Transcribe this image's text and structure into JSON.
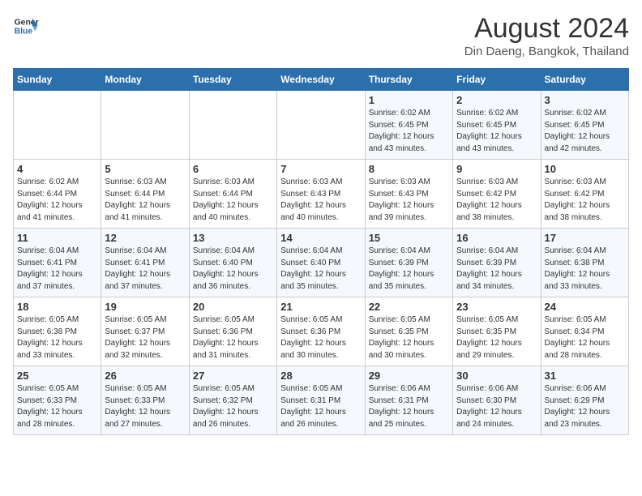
{
  "header": {
    "logo_line1": "General",
    "logo_line2": "Blue",
    "title": "August 2024",
    "subtitle": "Din Daeng, Bangkok, Thailand"
  },
  "days": [
    "Sunday",
    "Monday",
    "Tuesday",
    "Wednesday",
    "Thursday",
    "Friday",
    "Saturday"
  ],
  "weeks": [
    [
      {
        "date": "",
        "info": ""
      },
      {
        "date": "",
        "info": ""
      },
      {
        "date": "",
        "info": ""
      },
      {
        "date": "",
        "info": ""
      },
      {
        "date": "1",
        "info": "Sunrise: 6:02 AM\nSunset: 6:45 PM\nDaylight: 12 hours\nand 43 minutes."
      },
      {
        "date": "2",
        "info": "Sunrise: 6:02 AM\nSunset: 6:45 PM\nDaylight: 12 hours\nand 43 minutes."
      },
      {
        "date": "3",
        "info": "Sunrise: 6:02 AM\nSunset: 6:45 PM\nDaylight: 12 hours\nand 42 minutes."
      }
    ],
    [
      {
        "date": "4",
        "info": "Sunrise: 6:02 AM\nSunset: 6:44 PM\nDaylight: 12 hours\nand 41 minutes."
      },
      {
        "date": "5",
        "info": "Sunrise: 6:03 AM\nSunset: 6:44 PM\nDaylight: 12 hours\nand 41 minutes."
      },
      {
        "date": "6",
        "info": "Sunrise: 6:03 AM\nSunset: 6:44 PM\nDaylight: 12 hours\nand 40 minutes."
      },
      {
        "date": "7",
        "info": "Sunrise: 6:03 AM\nSunset: 6:43 PM\nDaylight: 12 hours\nand 40 minutes."
      },
      {
        "date": "8",
        "info": "Sunrise: 6:03 AM\nSunset: 6:43 PM\nDaylight: 12 hours\nand 39 minutes."
      },
      {
        "date": "9",
        "info": "Sunrise: 6:03 AM\nSunset: 6:42 PM\nDaylight: 12 hours\nand 38 minutes."
      },
      {
        "date": "10",
        "info": "Sunrise: 6:03 AM\nSunset: 6:42 PM\nDaylight: 12 hours\nand 38 minutes."
      }
    ],
    [
      {
        "date": "11",
        "info": "Sunrise: 6:04 AM\nSunset: 6:41 PM\nDaylight: 12 hours\nand 37 minutes."
      },
      {
        "date": "12",
        "info": "Sunrise: 6:04 AM\nSunset: 6:41 PM\nDaylight: 12 hours\nand 37 minutes."
      },
      {
        "date": "13",
        "info": "Sunrise: 6:04 AM\nSunset: 6:40 PM\nDaylight: 12 hours\nand 36 minutes."
      },
      {
        "date": "14",
        "info": "Sunrise: 6:04 AM\nSunset: 6:40 PM\nDaylight: 12 hours\nand 35 minutes."
      },
      {
        "date": "15",
        "info": "Sunrise: 6:04 AM\nSunset: 6:39 PM\nDaylight: 12 hours\nand 35 minutes."
      },
      {
        "date": "16",
        "info": "Sunrise: 6:04 AM\nSunset: 6:39 PM\nDaylight: 12 hours\nand 34 minutes."
      },
      {
        "date": "17",
        "info": "Sunrise: 6:04 AM\nSunset: 6:38 PM\nDaylight: 12 hours\nand 33 minutes."
      }
    ],
    [
      {
        "date": "18",
        "info": "Sunrise: 6:05 AM\nSunset: 6:38 PM\nDaylight: 12 hours\nand 33 minutes."
      },
      {
        "date": "19",
        "info": "Sunrise: 6:05 AM\nSunset: 6:37 PM\nDaylight: 12 hours\nand 32 minutes."
      },
      {
        "date": "20",
        "info": "Sunrise: 6:05 AM\nSunset: 6:36 PM\nDaylight: 12 hours\nand 31 minutes."
      },
      {
        "date": "21",
        "info": "Sunrise: 6:05 AM\nSunset: 6:36 PM\nDaylight: 12 hours\nand 30 minutes."
      },
      {
        "date": "22",
        "info": "Sunrise: 6:05 AM\nSunset: 6:35 PM\nDaylight: 12 hours\nand 30 minutes."
      },
      {
        "date": "23",
        "info": "Sunrise: 6:05 AM\nSunset: 6:35 PM\nDaylight: 12 hours\nand 29 minutes."
      },
      {
        "date": "24",
        "info": "Sunrise: 6:05 AM\nSunset: 6:34 PM\nDaylight: 12 hours\nand 28 minutes."
      }
    ],
    [
      {
        "date": "25",
        "info": "Sunrise: 6:05 AM\nSunset: 6:33 PM\nDaylight: 12 hours\nand 28 minutes."
      },
      {
        "date": "26",
        "info": "Sunrise: 6:05 AM\nSunset: 6:33 PM\nDaylight: 12 hours\nand 27 minutes."
      },
      {
        "date": "27",
        "info": "Sunrise: 6:05 AM\nSunset: 6:32 PM\nDaylight: 12 hours\nand 26 minutes."
      },
      {
        "date": "28",
        "info": "Sunrise: 6:05 AM\nSunset: 6:31 PM\nDaylight: 12 hours\nand 26 minutes."
      },
      {
        "date": "29",
        "info": "Sunrise: 6:06 AM\nSunset: 6:31 PM\nDaylight: 12 hours\nand 25 minutes."
      },
      {
        "date": "30",
        "info": "Sunrise: 6:06 AM\nSunset: 6:30 PM\nDaylight: 12 hours\nand 24 minutes."
      },
      {
        "date": "31",
        "info": "Sunrise: 6:06 AM\nSunset: 6:29 PM\nDaylight: 12 hours\nand 23 minutes."
      }
    ]
  ]
}
